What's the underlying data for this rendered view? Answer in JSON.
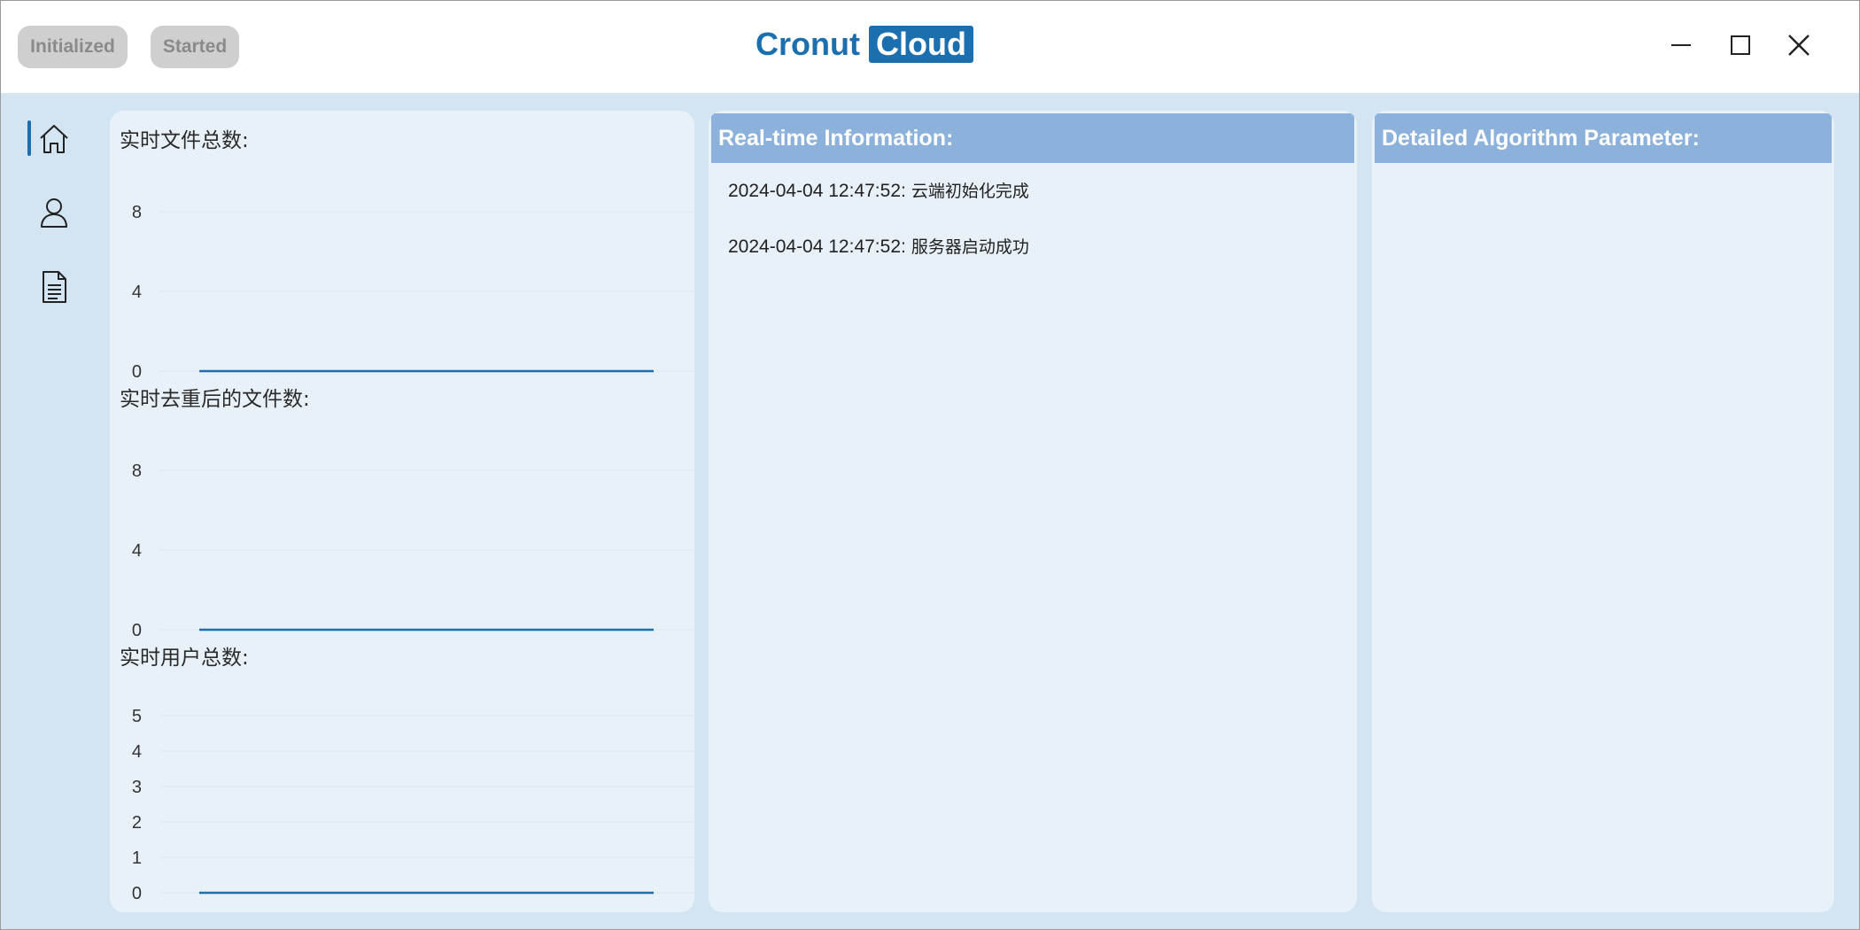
{
  "titlebar": {
    "status_initialized": "Initialized",
    "status_started": "Started",
    "brand_word1": "Cronut",
    "brand_word2": "Cloud"
  },
  "sidebar": {
    "items": [
      {
        "icon": "home-icon",
        "active": true
      },
      {
        "icon": "user-icon",
        "active": false
      },
      {
        "icon": "document-icon",
        "active": false
      }
    ]
  },
  "charts": [
    {
      "title": "实时文件总数:",
      "ticks": [
        "8",
        "4",
        "0"
      ]
    },
    {
      "title": "实时去重后的文件数:",
      "ticks": [
        "8",
        "4",
        "0"
      ]
    },
    {
      "title": "实时用户总数:",
      "ticks": [
        "5",
        "4",
        "3",
        "2",
        "1",
        "0"
      ]
    }
  ],
  "chart_data": [
    {
      "type": "line",
      "title": "实时文件总数:",
      "ylim": [
        0,
        8
      ],
      "yticks": [
        0,
        4,
        8
      ],
      "series": [
        {
          "values": [
            0,
            0
          ]
        }
      ],
      "grid": true
    },
    {
      "type": "line",
      "title": "实时去重后的文件数:",
      "ylim": [
        0,
        8
      ],
      "yticks": [
        0,
        4,
        8
      ],
      "series": [
        {
          "values": [
            0,
            0
          ]
        }
      ],
      "grid": true
    },
    {
      "type": "line",
      "title": "实时用户总数:",
      "ylim": [
        0,
        5
      ],
      "yticks": [
        0,
        1,
        2,
        3,
        4,
        5
      ],
      "series": [
        {
          "values": [
            0,
            0
          ]
        }
      ],
      "grid": true
    }
  ],
  "info_panel": {
    "title": "Real-time Information:",
    "logs": [
      {
        "time": "2024-04-04 12:47:52:",
        "message": "云端初始化完成"
      },
      {
        "time": "2024-04-04 12:47:52:",
        "message": "服务器启动成功"
      }
    ]
  },
  "params_panel": {
    "title": "Detailed Algorithm Parameter:"
  },
  "colors": {
    "accent": "#1c6fae",
    "header_bg": "#8cb1db",
    "panel_bg": "#e8f0f8",
    "window_bg": "#d3e4f3",
    "line": "#1c6fae"
  }
}
